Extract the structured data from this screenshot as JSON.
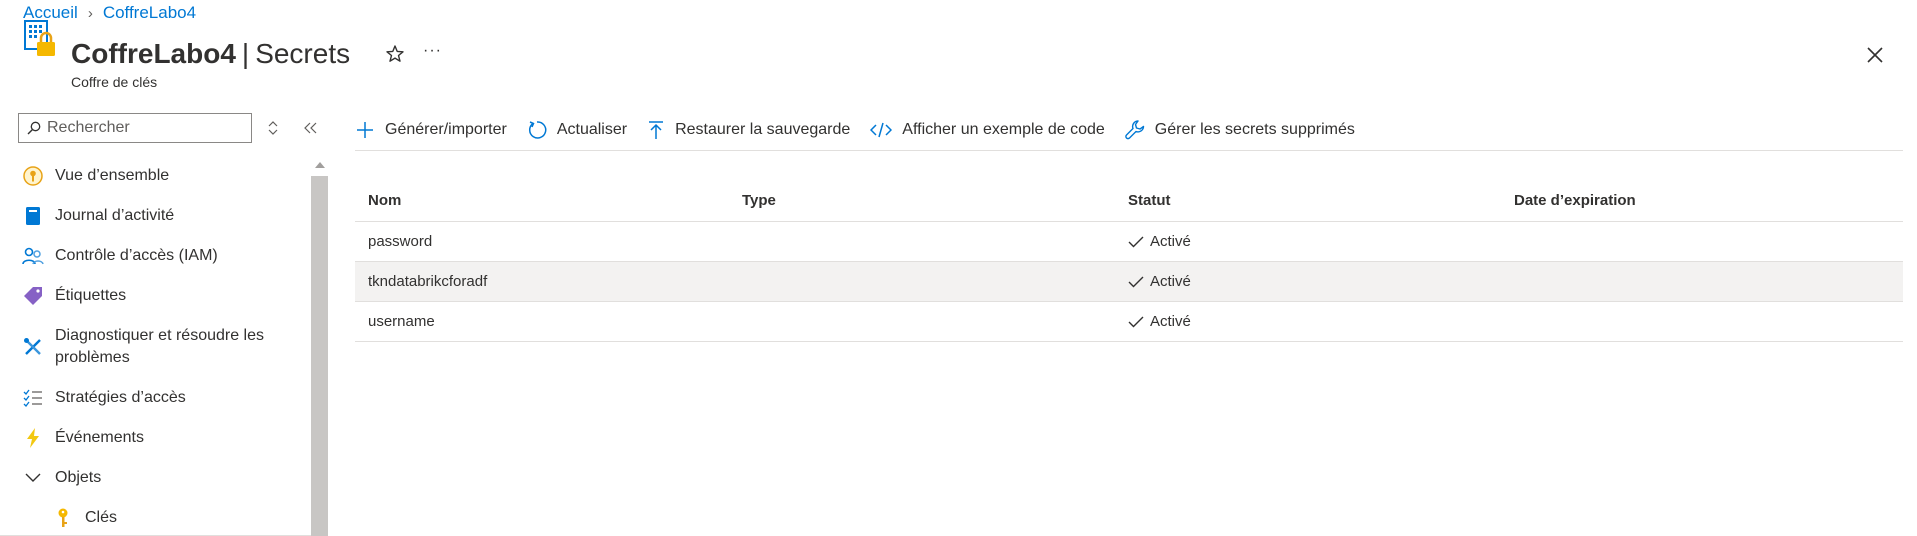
{
  "breadcrumb": {
    "home": "Accueil",
    "current": "CoffreLabo4"
  },
  "header": {
    "resource_name": "CoffreLabo4",
    "separator": "|",
    "page_name": "Secrets",
    "subtitle": "Coffre de clés",
    "more_label": "···"
  },
  "sidebar": {
    "search_placeholder": "Rechercher",
    "items": [
      {
        "label": "Vue d’ensemble",
        "icon": "key-circle-icon"
      },
      {
        "label": "Journal d’activité",
        "icon": "book-icon"
      },
      {
        "label": "Contrôle d’accès (IAM)",
        "icon": "people-icon"
      },
      {
        "label": "Étiquettes",
        "icon": "tag-icon"
      },
      {
        "label": "Diagnostiquer et résoudre les problèmes",
        "icon": "tools-icon"
      },
      {
        "label": "Stratégies d’accès",
        "icon": "checklist-icon"
      },
      {
        "label": "Événements",
        "icon": "lightning-icon"
      },
      {
        "label": "Objets",
        "icon": "chevron-down-icon"
      },
      {
        "label": "Clés",
        "icon": "key-icon"
      }
    ]
  },
  "toolbar": {
    "generate": "Générer/importer",
    "refresh": "Actualiser",
    "restore": "Restaurer la sauvegarde",
    "code": "Afficher un exemple de code",
    "deleted": "Gérer les secrets supprimés"
  },
  "table": {
    "columns": [
      "Nom",
      "Type",
      "Statut",
      "Date d’expiration"
    ],
    "rows": [
      {
        "name": "password",
        "type": "",
        "status": "Activé",
        "expiry": ""
      },
      {
        "name": "tkndatabrikcforadf",
        "type": "",
        "status": "Activé",
        "expiry": ""
      },
      {
        "name": "username",
        "type": "",
        "status": "Activé",
        "expiry": ""
      }
    ]
  },
  "colors": {
    "accent": "#0078d4",
    "selected_row": "#f3f2f1",
    "divider": "#e1dfdd"
  }
}
